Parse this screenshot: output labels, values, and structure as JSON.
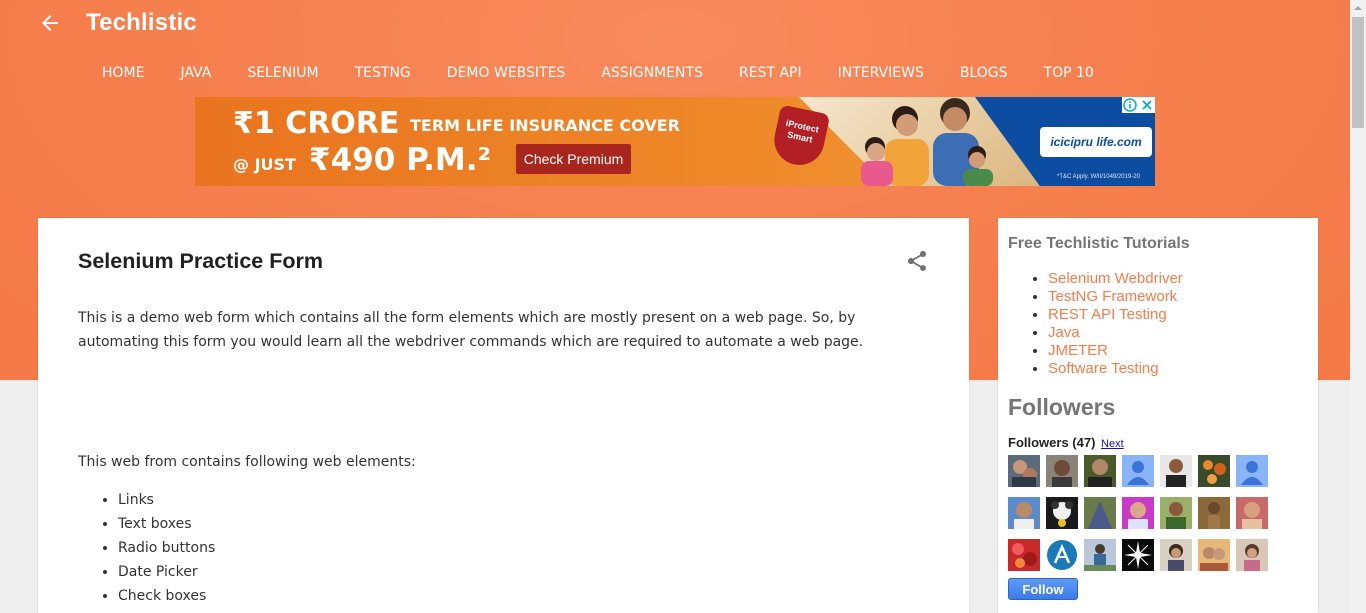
{
  "header": {
    "site_title": "Techlistic",
    "nav": [
      "HOME",
      "JAVA",
      "SELENIUM",
      "TESTNG",
      "DEMO WEBSITES",
      "ASSIGNMENTS",
      "REST API",
      "INTERVIEWS",
      "BLOGS",
      "TOP 10"
    ]
  },
  "ad": {
    "headline": "₹1 CRORE",
    "subline": "TERM LIFE INSURANCE COVER",
    "price_prefix": "@ JUST",
    "price": "₹490 P.M.²",
    "cta": "Check Premium",
    "shield_text": "iProtect Smart",
    "logo": "icicipr ulife.com",
    "logo_text": "icicipru life.com",
    "disclaimer": "*T&C Apply. W/II/1049/2019-20"
  },
  "post": {
    "title": "Selenium Practice Form",
    "intro": "This is a demo web form which contains all the form elements which are mostly present on a web page. So, by automating this form you would learn all the webdriver commands which are required to automate a web page.",
    "elements_intro": "This web from contains following web elements:",
    "elements": [
      "Links",
      "Text boxes",
      "Radio buttons",
      "Date Picker",
      "Check boxes"
    ]
  },
  "sidebar": {
    "tutorials_title": "Free Techlistic Tutorials",
    "tutorials": [
      "Selenium Webdriver",
      "TestNG Framework",
      "REST API Testing",
      "Java",
      "JMETER",
      "Software Testing"
    ],
    "followers_title": "Followers",
    "followers_count": "Followers (47)",
    "next_label": "Next",
    "follow_label": "Follow"
  },
  "colors": {
    "header_orange": "#f6804f",
    "link_orange": "#f57c4a",
    "follow_blue": "#3b7ae6"
  }
}
